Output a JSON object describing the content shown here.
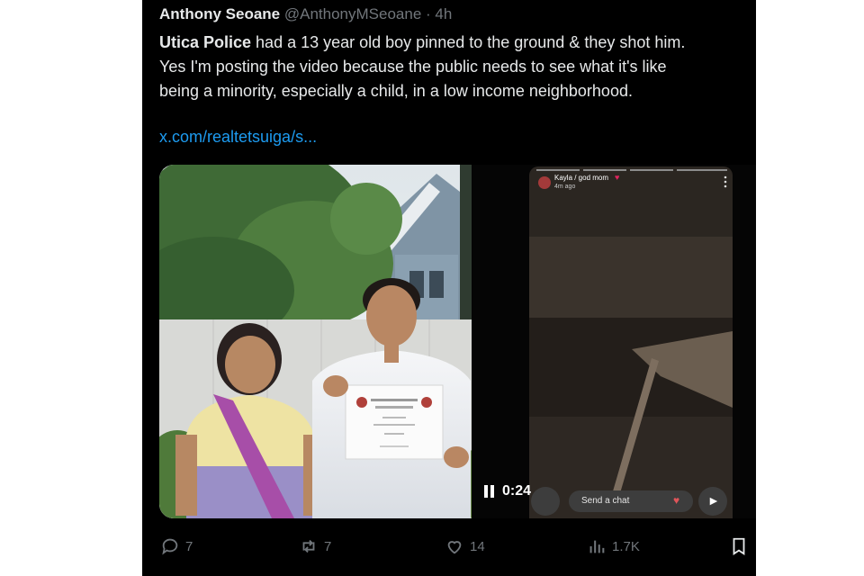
{
  "tweet": {
    "author_name": "Anthony Seoane",
    "author_handle": "@AnthonyMSeoane",
    "separator": "·",
    "time": "4h",
    "text_bold": "Utica Police",
    "text_line1_rest": " had a 13 year old boy pinned to the ground & they shot him.",
    "text_line2": "Yes I'm posting the video because the public needs to see what it's like",
    "text_line3": "being a minority, especially a child, in a low income neighborhood.",
    "link": "x.com/realtetsuiga/s..."
  },
  "video": {
    "story_name": "Kayla / god mom",
    "story_time": "4m ago",
    "duration": "0:24",
    "chat_placeholder": "Send a chat"
  },
  "stats": {
    "replies": "7",
    "reposts": "7",
    "likes": "14",
    "views": "1.7K"
  },
  "colors": {
    "background": "#000000",
    "text_primary": "#e7e9ea",
    "text_secondary": "#71767b",
    "link": "#1d9bf0"
  }
}
